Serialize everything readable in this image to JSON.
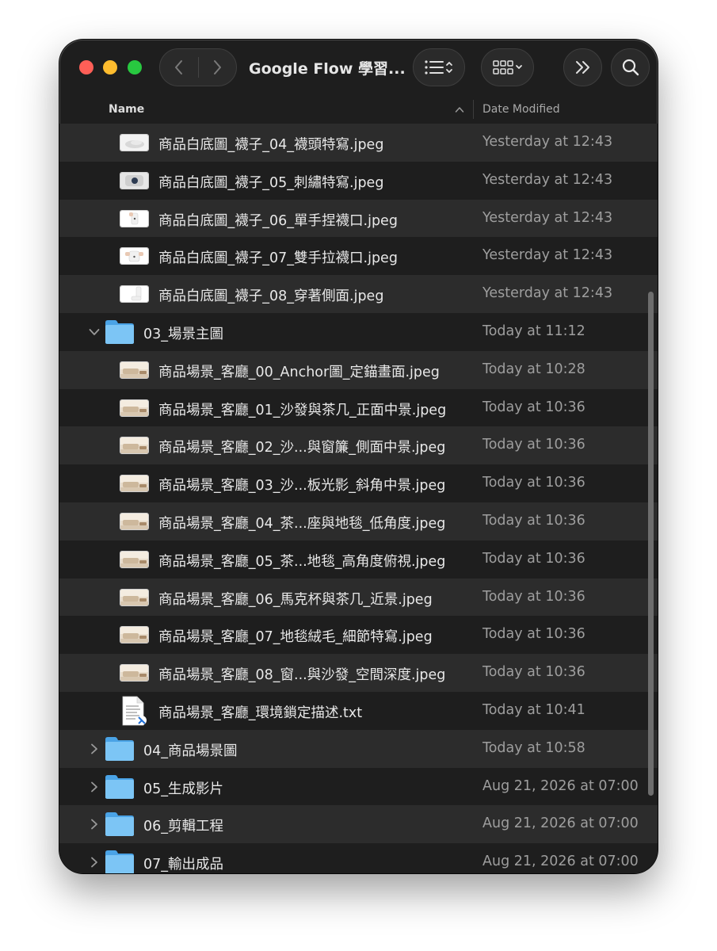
{
  "window": {
    "title": "Google Flow 學習...",
    "traffic_lights": {
      "close": "#ff5f57",
      "minimize": "#febc2e",
      "zoom": "#28c840"
    },
    "toolbar_icons": [
      "chevron-left-icon",
      "chevron-right-icon",
      "list-view-icon",
      "grid-view-icon",
      "double-chevron-right-icon",
      "search-icon"
    ]
  },
  "columns": {
    "name": "Name",
    "date": "Date Modified"
  },
  "rows": [
    {
      "kind": "file",
      "thumb": "sock-white",
      "name": "商品白底圖_襪子_04_襪頭特寫.jpeg",
      "date": "Yesterday at 12:43"
    },
    {
      "kind": "file",
      "thumb": "sock-embroidery",
      "name": "商品白底圖_襪子_05_刺繡特寫.jpeg",
      "date": "Yesterday at 12:43"
    },
    {
      "kind": "file",
      "thumb": "sock-hand",
      "name": "商品白底圖_襪子_06_單手捏襪口.jpeg",
      "date": "Yesterday at 12:43"
    },
    {
      "kind": "file",
      "thumb": "sock-hands",
      "name": "商品白底圖_襪子_07_雙手拉襪口.jpeg",
      "date": "Yesterday at 12:43"
    },
    {
      "kind": "file",
      "thumb": "sock-side",
      "name": "商品白底圖_襪子_08_穿著側面.jpeg",
      "date": "Yesterday at 12:43"
    },
    {
      "kind": "folder",
      "expanded": true,
      "name": "03_場景主圖",
      "date": "Today at 11:12"
    },
    {
      "kind": "file",
      "thumb": "room",
      "name": "商品場景_客廳_00_Anchor圖_定錨畫面.jpeg",
      "date": "Today at 10:28"
    },
    {
      "kind": "file",
      "thumb": "room",
      "name": "商品場景_客廳_01_沙發與茶几_正面中景.jpeg",
      "date": "Today at 10:36"
    },
    {
      "kind": "file",
      "thumb": "room",
      "name": "商品場景_客廳_02_沙...與窗簾_側面中景.jpeg",
      "date": "Today at 10:36"
    },
    {
      "kind": "file",
      "thumb": "room",
      "name": "商品場景_客廳_03_沙...板光影_斜角中景.jpeg",
      "date": "Today at 10:36"
    },
    {
      "kind": "file",
      "thumb": "room",
      "name": "商品場景_客廳_04_茶...座與地毯_低角度.jpeg",
      "date": "Today at 10:36"
    },
    {
      "kind": "file",
      "thumb": "room",
      "name": "商品場景_客廳_05_茶...地毯_高角度俯視.jpeg",
      "date": "Today at 10:36"
    },
    {
      "kind": "file",
      "thumb": "room",
      "name": "商品場景_客廳_06_馬克杯與茶几_近景.jpeg",
      "date": "Today at 10:36"
    },
    {
      "kind": "file",
      "thumb": "room",
      "name": "商品場景_客廳_07_地毯絨毛_細節特寫.jpeg",
      "date": "Today at 10:36"
    },
    {
      "kind": "file",
      "thumb": "room",
      "name": "商品場景_客廳_08_窗...與沙發_空間深度.jpeg",
      "date": "Today at 10:36"
    },
    {
      "kind": "txt",
      "name": "商品場景_客廳_環境鎖定描述.txt",
      "date": "Today at 10:41"
    },
    {
      "kind": "folder",
      "expanded": false,
      "name": "04_商品場景圖",
      "date": "Today at 10:58"
    },
    {
      "kind": "folder",
      "expanded": false,
      "name": "05_生成影片",
      "date": "Aug 21, 2026 at 07:00"
    },
    {
      "kind": "folder",
      "expanded": false,
      "name": "06_剪輯工程",
      "date": "Aug 21, 2026 at 07:00"
    },
    {
      "kind": "folder",
      "expanded": false,
      "name": "07_輸出成品",
      "date": "Aug 21, 2026 at 07:00"
    }
  ]
}
